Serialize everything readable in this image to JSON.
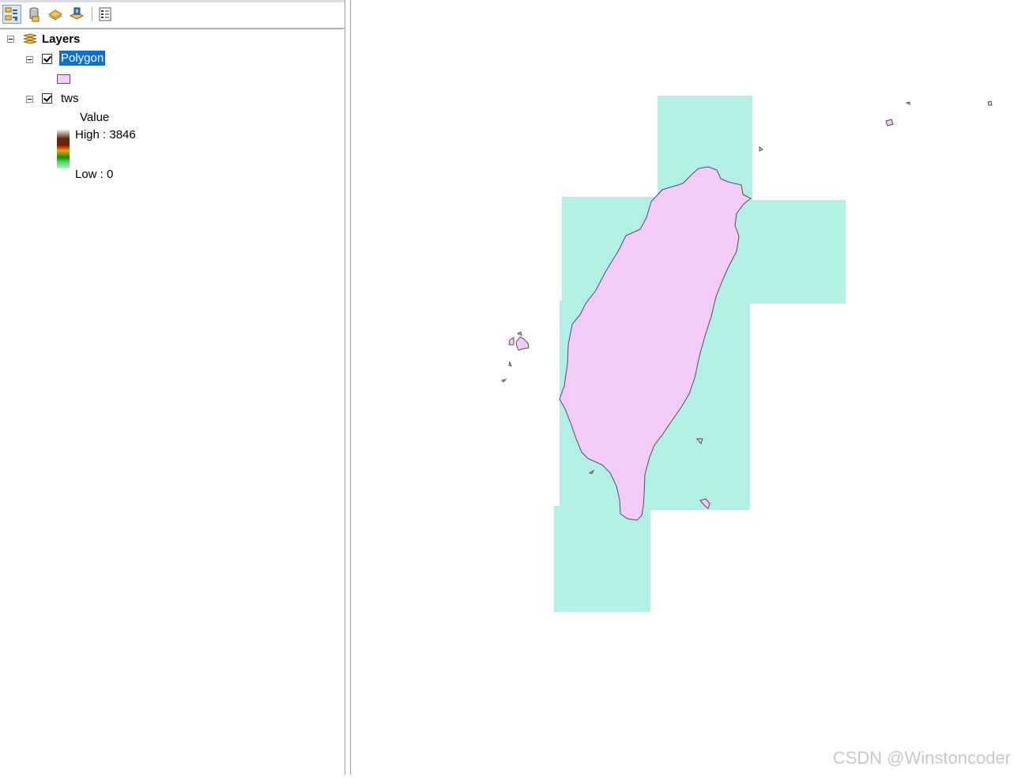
{
  "toc": {
    "toolbar": {
      "buttons": [
        {
          "icon": "list-by-drawing-order-icon"
        },
        {
          "icon": "list-by-source-icon"
        },
        {
          "icon": "list-by-visibility-icon"
        },
        {
          "icon": "list-by-selection-icon"
        },
        {
          "icon": "options-icon"
        }
      ]
    },
    "root": {
      "label": "Layers"
    },
    "layers": [
      {
        "label": "Polygon",
        "checked": true,
        "selected": true,
        "fill": "#f2ccf7"
      },
      {
        "label": "tws",
        "checked": true,
        "legend": {
          "field": "Value",
          "high": "High : 3846",
          "low": "Low : 0"
        }
      }
    ]
  },
  "map": {
    "raster_color": "#b2f0e6",
    "polygon_color": "#f2ccf7",
    "outline_color": "#5a4a5a"
  },
  "watermark": "CSDN @Winstoncoder"
}
